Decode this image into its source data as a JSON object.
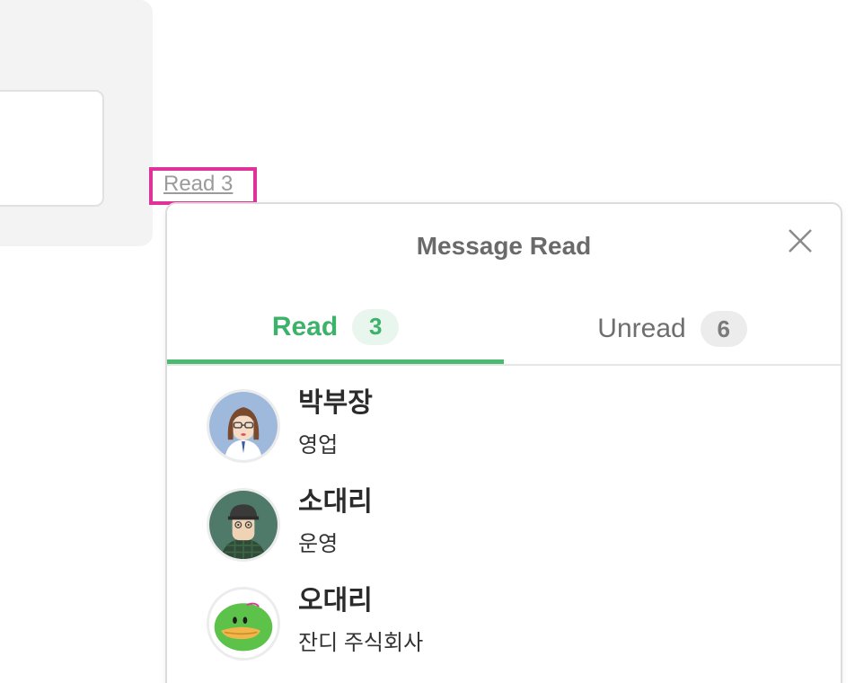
{
  "background_link": {
    "label": "Read 3"
  },
  "popup": {
    "title": "Message Read",
    "tabs": [
      {
        "label": "Read",
        "count": "3",
        "active": true
      },
      {
        "label": "Unread",
        "count": "6",
        "active": false
      }
    ],
    "users": [
      {
        "name": "박부장",
        "dept": "영업",
        "avatar": "woman-with-glasses-avatar"
      },
      {
        "name": "소대리",
        "dept": "운영",
        "avatar": "man-with-cap-avatar"
      },
      {
        "name": "오대리",
        "dept": "잔디 주식회사",
        "avatar": "green-duck-avatar"
      }
    ]
  },
  "annotation": {
    "highlight_color": "#e0339a",
    "accent_color": "#3db26a"
  }
}
